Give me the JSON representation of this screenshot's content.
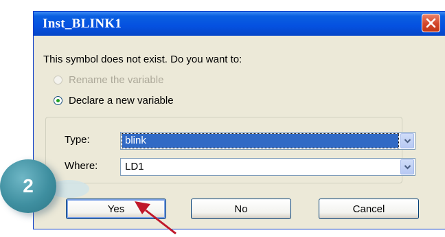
{
  "window": {
    "title": "Inst_BLINK1"
  },
  "message": "This symbol does not exist. Do you want to:",
  "options": [
    {
      "label": "Rename the variable",
      "enabled": false,
      "selected": false
    },
    {
      "label": "Declare a new variable",
      "enabled": true,
      "selected": true
    }
  ],
  "fields": {
    "type": {
      "label": "Type:",
      "value": "blink"
    },
    "where": {
      "label": "Where:",
      "value": "LD1"
    }
  },
  "buttons": {
    "yes": "Yes",
    "no": "No",
    "cancel": "Cancel"
  },
  "annotation": {
    "step": "2",
    "color": "#3f8fa0",
    "arrow_color": "#c0182a"
  },
  "colors": {
    "titlebar": "#0551e0",
    "selection": "#316ac5",
    "close": "#d3462a"
  }
}
